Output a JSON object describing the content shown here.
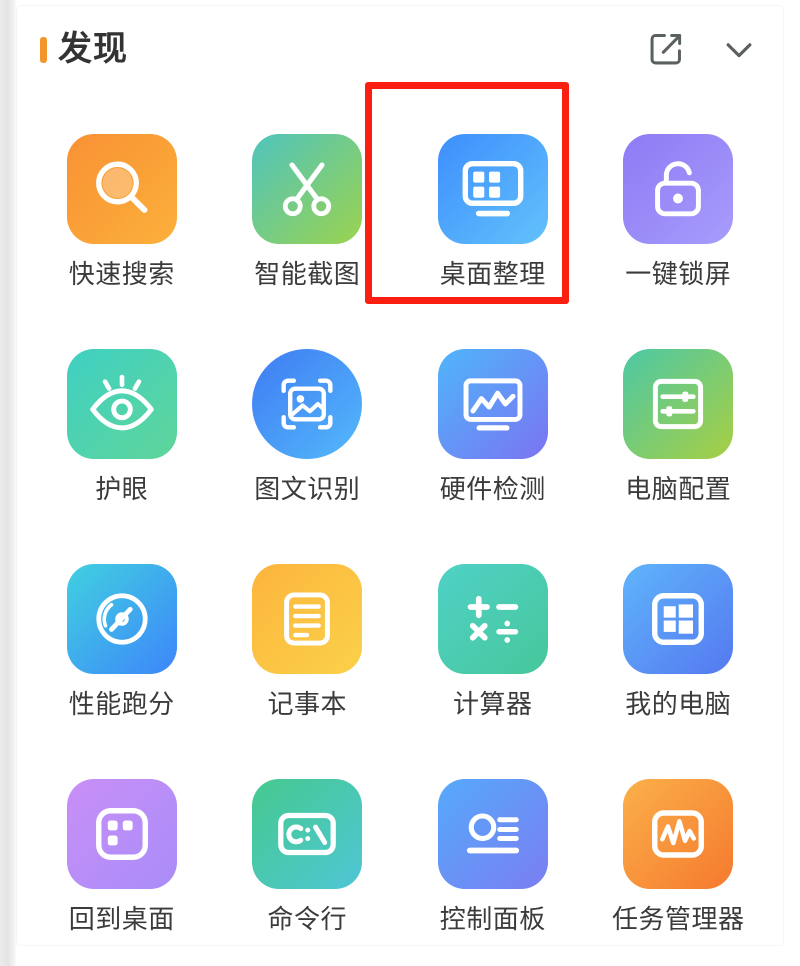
{
  "header": {
    "title": "发现",
    "accent_color": "#f2962c",
    "edit_icon": "compose-edit-icon",
    "collapse_icon": "chevron-down-icon"
  },
  "highlight": {
    "color": "#fb1f12",
    "target_label": "桌面整理"
  },
  "apps": [
    {
      "label": "快速搜索",
      "icon": "magnifier-icon",
      "grad_from": "#f99134",
      "grad_to": "#fbb03b",
      "shape": "squircle"
    },
    {
      "label": "智能截图",
      "icon": "scissors-icon",
      "grad_from": "#4fc4bd",
      "grad_to": "#9bd34f",
      "shape": "squircle"
    },
    {
      "label": "桌面整理",
      "icon": "desktop-organize-icon",
      "grad_from": "#3d8efc",
      "grad_to": "#63c2fb",
      "shape": "squircle"
    },
    {
      "label": "一键锁屏",
      "icon": "lock-icon",
      "grad_from": "#8d7bf5",
      "grad_to": "#a79cfb",
      "shape": "squircle"
    },
    {
      "label": "护眼",
      "icon": "eye-icon",
      "grad_from": "#3fd0c3",
      "grad_to": "#5fd59a",
      "shape": "squircle"
    },
    {
      "label": "图文识别",
      "icon": "image-scan-icon",
      "grad_from": "#3f7bf3",
      "grad_to": "#53b9fb",
      "shape": "circle"
    },
    {
      "label": "硬件检测",
      "icon": "monitor-wave-icon",
      "grad_from": "#4fb5fa",
      "grad_to": "#7b74f2",
      "shape": "squircle"
    },
    {
      "label": "电脑配置",
      "icon": "sliders-icon",
      "grad_from": "#4cc8a6",
      "grad_to": "#a8cf42",
      "shape": "squircle"
    },
    {
      "label": "性能跑分",
      "icon": "gauge-icon",
      "grad_from": "#41d0e0",
      "grad_to": "#3d86fa",
      "shape": "squircle"
    },
    {
      "label": "记事本",
      "icon": "notepad-icon",
      "grad_from": "#fcb53c",
      "grad_to": "#fbd14a",
      "shape": "squircle"
    },
    {
      "label": "计算器",
      "icon": "calculator-icon",
      "grad_from": "#4fd1c7",
      "grad_to": "#47c79a",
      "shape": "squircle"
    },
    {
      "label": "我的电脑",
      "icon": "windows-logo-icon",
      "grad_from": "#5fb4fb",
      "grad_to": "#5579f0",
      "shape": "squircle"
    },
    {
      "label": "回到桌面",
      "icon": "show-desktop-icon",
      "grad_from": "#c98ef7",
      "grad_to": "#a98df8",
      "shape": "squircle"
    },
    {
      "label": "命令行",
      "icon": "terminal-icon",
      "grad_from": "#46c98e",
      "grad_to": "#4fc6d6",
      "shape": "squircle"
    },
    {
      "label": "控制面板",
      "icon": "control-panel-icon",
      "grad_from": "#55a9fb",
      "grad_to": "#7b7ef1",
      "shape": "squircle"
    },
    {
      "label": "任务管理器",
      "icon": "task-manager-icon",
      "grad_from": "#fbb04a",
      "grad_to": "#f5792e",
      "shape": "squircle"
    }
  ]
}
